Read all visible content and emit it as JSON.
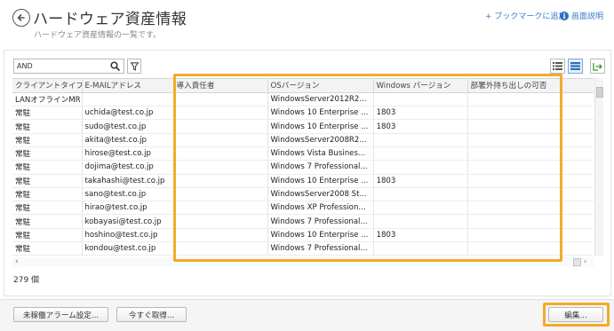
{
  "header": {
    "title": "ハードウェア資産情報",
    "subtitle": "ハードウェア資産情報の一覧です。",
    "bookmark_label": "+ ブックマークに追加",
    "help_label": "画面説明",
    "help_icon_glyph": "i"
  },
  "toolbar": {
    "search_value": "AND"
  },
  "table": {
    "columns": [
      "クライアントタイプ",
      "E-MAILアドレス",
      "導入責任者",
      "OSバージョン",
      "Windows バージョン",
      "部署外持ち出しの可否"
    ],
    "rows": [
      [
        "LANオフラインMR",
        "",
        "",
        "WindowsServer2012R2...",
        "",
        ""
      ],
      [
        "常駐",
        "uchida@test.co.jp",
        "",
        "Windows 10 Enterprise ...",
        "1803",
        ""
      ],
      [
        "常駐",
        "sudo@test.co.jp",
        "",
        "Windows 10 Enterprise ...",
        "1803",
        ""
      ],
      [
        "常駐",
        "akita@test.co.jp",
        "",
        "WindowsServer2008R2...",
        "",
        ""
      ],
      [
        "常駐",
        "hirose@test.co.jp",
        "",
        "Windows Vista Busines...",
        "",
        ""
      ],
      [
        "常駐",
        "dojima@test.co.jp",
        "",
        "Windows 7 Professional...",
        "",
        ""
      ],
      [
        "常駐",
        "takahashi@test.co.jp",
        "",
        "Windows 10 Enterprise ...",
        "1803",
        ""
      ],
      [
        "常駐",
        "sano@test.co.jp",
        "",
        "WindowsServer2008 St...",
        "",
        ""
      ],
      [
        "常駐",
        "hirao@test.co.jp",
        "",
        "Windows XP Profession...",
        "",
        ""
      ],
      [
        "常駐",
        "kobayasi@test.co.jp",
        "",
        "Windows 7 Professional...",
        "",
        ""
      ],
      [
        "常駐",
        "hoshino@test.co.jp",
        "",
        "Windows 10 Enterprise ...",
        "1803",
        ""
      ],
      [
        "常駐",
        "kondou@test.co.jp",
        "",
        "Windows 7 Professional...",
        "",
        ""
      ]
    ],
    "count_label": "279 個"
  },
  "scroll": {
    "left_arrow": "‹",
    "right_arrow": "›"
  },
  "footer": {
    "alarm_button": "未稼働アラーム設定...",
    "fetch_button": "今すぐ取得...",
    "edit_button": "編集..."
  },
  "colors": {
    "highlight": "#f4aa2a",
    "link": "#3a7bc8"
  }
}
